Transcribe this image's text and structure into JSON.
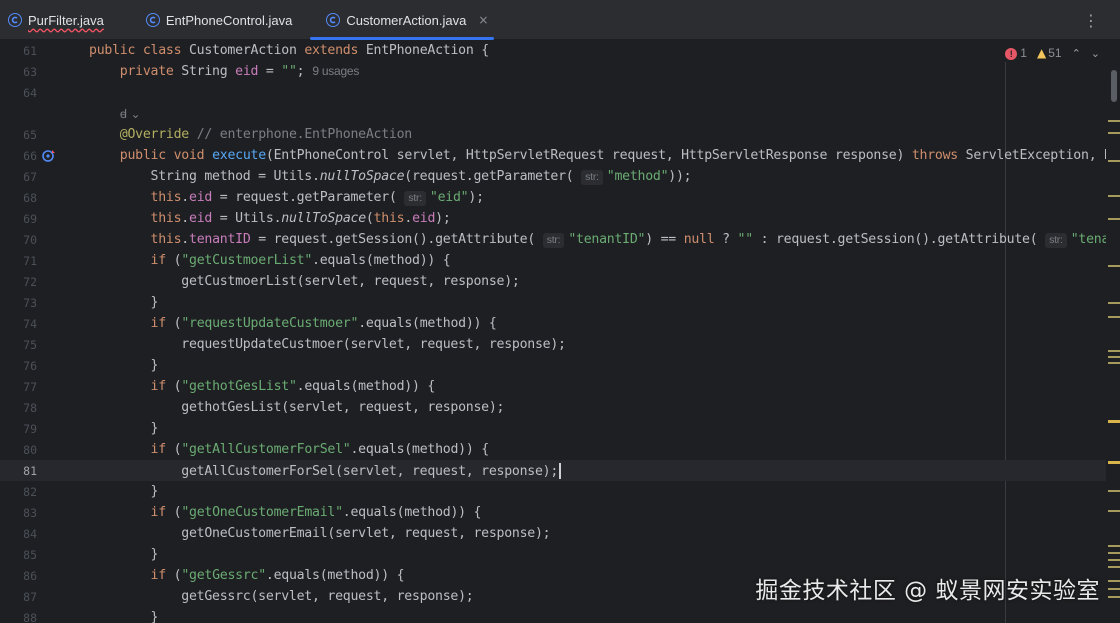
{
  "tabs": [
    {
      "label": "PurFilter.java",
      "active": false,
      "has_error": true
    },
    {
      "label": "EntPhoneControl.java",
      "active": false,
      "has_error": false
    },
    {
      "label": "CustomerAction.java",
      "active": true,
      "has_error": false
    }
  ],
  "tab_close_glyph": "×",
  "tabbar_more_glyph": "⋮",
  "inspections": {
    "errors": "1",
    "warnings": "51"
  },
  "editor": {
    "current_line": "81",
    "lines": [
      {
        "num": "61"
      },
      {
        "num": "63",
        "usages": "9 usages"
      },
      {
        "num": "64"
      },
      {
        "num": "",
        "fold": "ꟈ ⌄"
      },
      {
        "num": "65"
      },
      {
        "num": "66"
      },
      {
        "num": "67"
      },
      {
        "num": "68"
      },
      {
        "num": "69"
      },
      {
        "num": "70"
      },
      {
        "num": "71"
      },
      {
        "num": "72"
      },
      {
        "num": "73"
      },
      {
        "num": "74"
      },
      {
        "num": "75"
      },
      {
        "num": "76"
      },
      {
        "num": "77"
      },
      {
        "num": "78"
      },
      {
        "num": "79"
      },
      {
        "num": "80"
      },
      {
        "num": "81"
      },
      {
        "num": "82"
      },
      {
        "num": "83"
      },
      {
        "num": "84"
      },
      {
        "num": "85"
      },
      {
        "num": "86"
      },
      {
        "num": "87"
      },
      {
        "num": "88"
      }
    ],
    "tokens": {
      "l61": [
        "public",
        " ",
        "class",
        " CustomerAction ",
        "extends",
        " EntPhoneAction {"
      ],
      "l63": [
        "    ",
        "private",
        " String ",
        "eid",
        " = ",
        "\"\"",
        ";"
      ],
      "l65": [
        "    ",
        "@Override",
        " ",
        "// enterphone.EntPhoneAction"
      ],
      "l66": [
        "    ",
        "public",
        " ",
        "void",
        " ",
        "execute",
        "(EntPhoneControl servlet, HttpServletRequest request, HttpServletResponse response) ",
        "throws",
        " ServletException, Num"
      ],
      "l67": [
        "        String method = Utils.",
        "nullToSpace",
        "(request.getParameter( ",
        "str:",
        "\"method\"",
        "));"
      ],
      "l68": [
        "        ",
        "this",
        ".",
        "eid",
        " = request.getParameter( ",
        "str:",
        "\"eid\"",
        ");"
      ],
      "l69": [
        "        ",
        "this",
        ".",
        "eid",
        " = Utils.",
        "nullToSpace",
        "(",
        "this",
        ".",
        "eid",
        ");"
      ],
      "l70": [
        "        ",
        "this",
        ".",
        "tenantID",
        " = request.getSession().getAttribute( ",
        "str:",
        "\"tenantID\"",
        ") == ",
        "null",
        " ? ",
        "\"\"",
        " : request.getSession().getAttribute( ",
        "str:",
        "\"tenantI"
      ],
      "l71": [
        "        ",
        "if",
        " (",
        "\"getCustmoerList\"",
        ".equals(method)) {"
      ],
      "l72": [
        "            getCustmoerList(servlet, request, response);"
      ],
      "l73": [
        "        }"
      ],
      "l74": [
        "        ",
        "if",
        " (",
        "\"requestUpdateCustmoer\"",
        ".equals(method)) {"
      ],
      "l75": [
        "            requestUpdateCustmoer(servlet, request, response);"
      ],
      "l76": [
        "        }"
      ],
      "l77": [
        "        ",
        "if",
        " (",
        "\"gethotGesList\"",
        ".equals(method)) {"
      ],
      "l78": [
        "            gethotGesList(servlet, request, response);"
      ],
      "l79": [
        "        }"
      ],
      "l80": [
        "        ",
        "if",
        " (",
        "\"getAllCustomerForSel\"",
        ".equals(method)) {"
      ],
      "l81": [
        "            getAllCustomerForSel(servlet, request, response);"
      ],
      "l82": [
        "        }"
      ],
      "l83": [
        "        ",
        "if",
        " (",
        "\"getOneCustomerEmail\"",
        ".equals(method)) {"
      ],
      "l84": [
        "            getOneCustomerEmail(servlet, request, response);"
      ],
      "l85": [
        "        }"
      ],
      "l86": [
        "        ",
        "if",
        " (",
        "\"getGessrc\"",
        ".equals(method)) {"
      ],
      "l87": [
        "            getGessrc(servlet, request, response);"
      ],
      "l88": [
        "        }"
      ]
    }
  },
  "colors": {
    "keyword": "#cf8e6d",
    "string": "#6aab73",
    "function": "#56a8f5",
    "field": "#c77dbb",
    "annotation": "#b3ae60",
    "accent": "#3574f0",
    "background": "#1e1f22"
  },
  "watermark": "掘金技术社区 @ 蚁景网安实验室"
}
